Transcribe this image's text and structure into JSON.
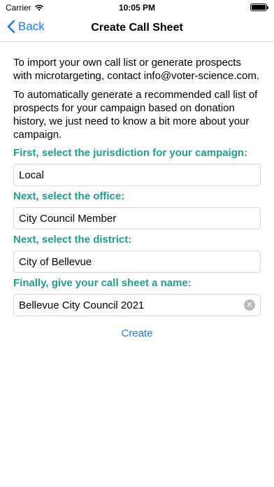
{
  "status_bar": {
    "carrier": "Carrier",
    "time": "10:05 PM"
  },
  "nav": {
    "back_label": "Back",
    "title": "Create Call Sheet"
  },
  "intro": {
    "import_text": "To import your own call list or generate prospects with microtargeting, contact info@voter-science.com.",
    "generate_text": "To automatically generate a recommended call list of prospects for your campaign based on donation history, we just need to know a bit more about your campaign."
  },
  "form": {
    "jurisdiction_label": "First, select the jurisdiction for your campaign:",
    "jurisdiction_value": "Local",
    "office_label": "Next, select the office:",
    "office_value": "City Council Member",
    "district_label": "Next, select the district:",
    "district_value": "City of Bellevue",
    "name_label": "Finally, give your call sheet a name:",
    "name_value": "Bellevue City Council 2021",
    "create_label": "Create"
  },
  "colors": {
    "accent_blue": "#1a7bff",
    "label_teal": "#1e9f8a"
  },
  "icons": {
    "wifi": "wifi-icon",
    "battery": "battery-icon",
    "back": "chevron-left-icon",
    "clear": "clear-text-icon"
  }
}
